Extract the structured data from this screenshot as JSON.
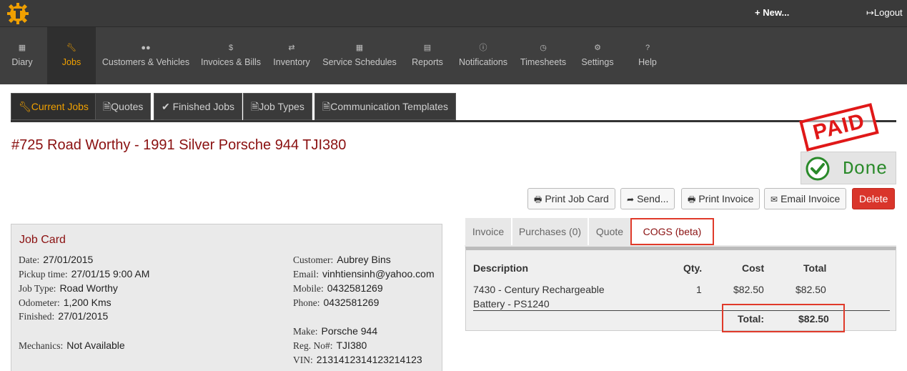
{
  "header": {
    "new_label": "New...",
    "logout_label": "Logout"
  },
  "nav": [
    {
      "label": "Diary",
      "icon": "calendar-icon"
    },
    {
      "label": "Jobs",
      "icon": "wrench-icon"
    },
    {
      "label": "Customers & Vehicles",
      "icon": "users-icon"
    },
    {
      "label": "Invoices & Bills",
      "icon": "dollar-icon"
    },
    {
      "label": "Inventory",
      "icon": "retweet-icon"
    },
    {
      "label": "Service Schedules",
      "icon": "calendar-icon"
    },
    {
      "label": "Reports",
      "icon": "bar-chart-icon"
    },
    {
      "label": "Notifications",
      "icon": "info-icon"
    },
    {
      "label": "Timesheets",
      "icon": "clock-icon"
    },
    {
      "label": "Settings",
      "icon": "gears-icon"
    },
    {
      "label": "Help",
      "icon": "question-icon"
    }
  ],
  "subtabs": [
    {
      "label": "Current Jobs"
    },
    {
      "label": "Quotes"
    },
    {
      "label": "Finished Jobs"
    },
    {
      "label": "Job Types"
    },
    {
      "label": "Communication Templates"
    }
  ],
  "job": {
    "title": "#725 Road Worthy - 1991 Silver Porsche 944 TJI380"
  },
  "stamp": {
    "paid": "PAID",
    "done": "Done"
  },
  "actions": {
    "print_job_card": "Print Job Card",
    "send": "Send...",
    "print_invoice": "Print Invoice",
    "email_invoice": "Email Invoice",
    "delete": "Delete"
  },
  "jobcard": {
    "title": "Job Card",
    "date_k": "Date:",
    "date": "27/01/2015",
    "pickup_k": "Pickup time:",
    "pickup": "27/01/15 9:00 AM",
    "jobtype_k": "Job Type:",
    "jobtype": "Road Worthy",
    "odometer_k": "Odometer:",
    "odometer": "1,200 Kms",
    "finished_k": "Finished:",
    "finished": "27/01/2015",
    "mechanics_k": "Mechanics:",
    "mechanics": "Not Available",
    "customer_k": "Customer:",
    "customer": "Aubrey Bins",
    "email_k": "Email:",
    "email": "vinhtiensinh@yahoo.com",
    "mobile_k": "Mobile:",
    "mobile": "0432581269",
    "phone_k": "Phone:",
    "phone": "0432581269",
    "make_k": "Make:",
    "make": "Porsche 944",
    "rego_k": "Reg. No#:",
    "rego": "TJI380",
    "vin_k": "VIN:",
    "vin": "2131412314123214123"
  },
  "right_tabs": [
    {
      "label": "Invoice"
    },
    {
      "label": "Purchases (0)"
    },
    {
      "label": "Quote"
    },
    {
      "label": "COGS (beta)"
    }
  ],
  "cogs": {
    "headers": {
      "description": "Description",
      "qty": "Qty.",
      "cost": "Cost",
      "total": "Total"
    },
    "rows": [
      {
        "description_l1": "7430 - Century Rechargeable",
        "description_l2": "Battery - PS1240",
        "qty": "1",
        "cost": "$82.50",
        "total": "$82.50"
      }
    ],
    "total_label": "Total:",
    "total_value": "$82.50"
  },
  "colors": {
    "accent": "#f0a000",
    "title": "#8a1010",
    "danger": "#d9352b",
    "highlight": "#e03a2a",
    "done": "#2a8a2a"
  }
}
